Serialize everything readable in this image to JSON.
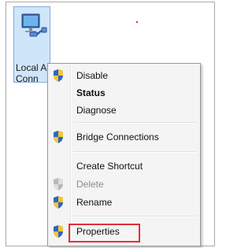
{
  "desktop_icon": {
    "label": "Local A\nConn",
    "icon": "network-connection-icon"
  },
  "context_menu": {
    "items": [
      {
        "label": "Disable",
        "icon": "uac-shield-icon",
        "style": "normal"
      },
      {
        "label": "Status",
        "icon": null,
        "style": "bold"
      },
      {
        "label": "Diagnose",
        "icon": null,
        "style": "normal"
      },
      {
        "label": "Bridge Connections",
        "icon": "uac-shield-icon",
        "style": "normal"
      },
      {
        "label": "Create Shortcut",
        "icon": null,
        "style": "normal"
      },
      {
        "label": "Delete",
        "icon": "uac-shield-icon",
        "style": "disabled"
      },
      {
        "label": "Rename",
        "icon": "uac-shield-icon",
        "style": "normal"
      },
      {
        "label": "Properties",
        "icon": "uac-shield-icon",
        "style": "normal"
      }
    ]
  },
  "colors": {
    "highlight_border": "#e0303a",
    "icon_selection": "#cfe5fa",
    "menu_background": "#f4f4f4"
  }
}
